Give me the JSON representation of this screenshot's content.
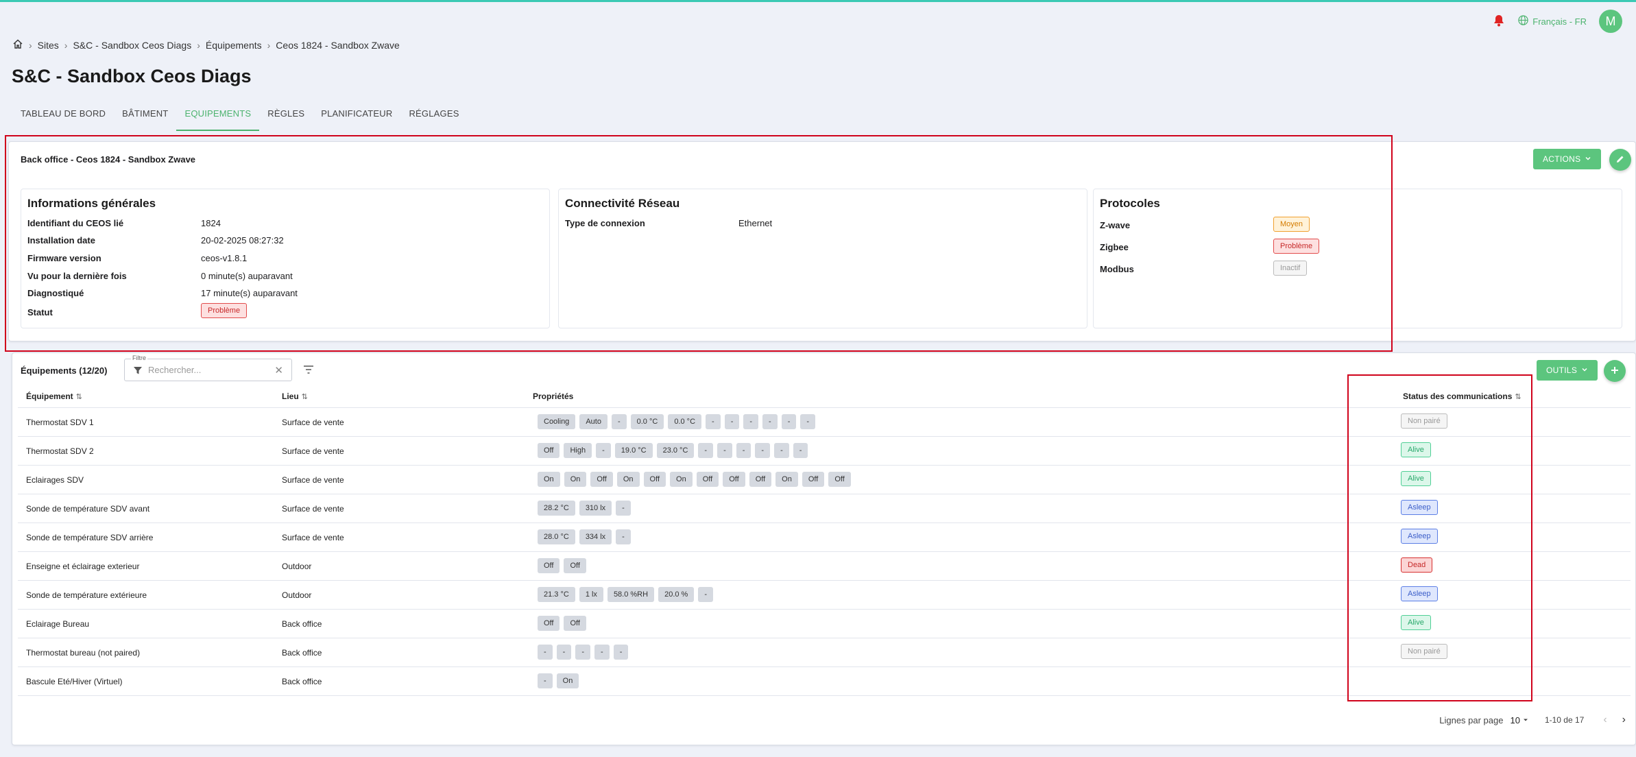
{
  "header": {
    "language": "Français - FR",
    "avatar_initial": "M"
  },
  "breadcrumb": [
    "Sites",
    "S&C - Sandbox Ceos Diags",
    "Équipements",
    "Ceos 1824 - Sandbox Zwave"
  ],
  "page_title": "S&C - Sandbox Ceos Diags",
  "tabs": [
    {
      "label": "TABLEAU DE BORD",
      "active": false
    },
    {
      "label": "BÂTIMENT",
      "active": false
    },
    {
      "label": "EQUIPEMENTS",
      "active": true
    },
    {
      "label": "RÈGLES",
      "active": false
    },
    {
      "label": "PLANIFICATEUR",
      "active": false
    },
    {
      "label": "RÉGLAGES",
      "active": false
    }
  ],
  "device_card": {
    "title": "Back office - Ceos 1824 - Sandbox Zwave",
    "actions_label": "ACTIONS",
    "general": {
      "heading": "Informations générales",
      "fields": [
        {
          "key": "Identifiant du CEOS lié",
          "value": "1824"
        },
        {
          "key": "Installation date",
          "value": "20-02-2025 08:27:32"
        },
        {
          "key": "Firmware version",
          "value": "ceos-v1.8.1"
        },
        {
          "key": "Vu pour la dernière fois",
          "value": "0 minute(s) auparavant"
        },
        {
          "key": "Diagnostiqué",
          "value": "17 minute(s) auparavant"
        }
      ],
      "status_key": "Statut",
      "status_value": "Problème"
    },
    "network": {
      "heading": "Connectivité Réseau",
      "key": "Type de connexion",
      "value": "Ethernet"
    },
    "protocols": {
      "heading": "Protocoles",
      "items": [
        {
          "name": "Z-wave",
          "status": "Moyen",
          "tone": "orange"
        },
        {
          "name": "Zigbee",
          "status": "Problème",
          "tone": "red"
        },
        {
          "name": "Modbus",
          "status": "Inactif",
          "tone": "grey"
        }
      ]
    }
  },
  "equipment_card": {
    "title": "Équipements (12/20)",
    "filter_legend": "Filtre",
    "filter_placeholder": "Rechercher...",
    "tools_label": "OUTILS",
    "columns": {
      "equipment": "Équipement",
      "location": "Lieu",
      "properties": "Propriétés",
      "comm_status": "Status des communications"
    },
    "rows": [
      {
        "name": "Thermostat SDV 1",
        "location": "Surface de vente",
        "props": [
          "Cooling",
          "Auto",
          "-",
          "0.0 °C",
          "0.0 °C",
          "-",
          "-",
          "-",
          "-",
          "-",
          "-"
        ],
        "status": "Non pairé",
        "tone": "grey"
      },
      {
        "name": "Thermostat SDV 2",
        "location": "Surface de vente",
        "props": [
          "Off",
          "High",
          "-",
          "19.0 °C",
          "23.0 °C",
          "-",
          "-",
          "-",
          "-",
          "-",
          "-"
        ],
        "status": "Alive",
        "tone": "green"
      },
      {
        "name": "Eclairages SDV",
        "location": "Surface de vente",
        "props": [
          "On",
          "On",
          "Off",
          "On",
          "Off",
          "On",
          "Off",
          "Off",
          "Off",
          "On",
          "Off",
          "Off"
        ],
        "status": "Alive",
        "tone": "green"
      },
      {
        "name": "Sonde de température SDV avant",
        "location": "Surface de vente",
        "props": [
          "28.2 °C",
          "310 lx",
          "-"
        ],
        "status": "Asleep",
        "tone": "blue"
      },
      {
        "name": "Sonde de température SDV arrière",
        "location": "Surface de vente",
        "props": [
          "28.0 °C",
          "334 lx",
          "-"
        ],
        "status": "Asleep",
        "tone": "blue"
      },
      {
        "name": "Enseigne et éclairage exterieur",
        "location": "Outdoor",
        "props": [
          "Off",
          "Off"
        ],
        "status": "Dead",
        "tone": "deadred"
      },
      {
        "name": "Sonde de température extérieure",
        "location": "Outdoor",
        "props": [
          "21.3 °C",
          "1 lx",
          "58.0 %RH",
          "20.0 %",
          "-"
        ],
        "status": "Asleep",
        "tone": "blue"
      },
      {
        "name": "Eclairage Bureau",
        "location": "Back office",
        "props": [
          "Off",
          "Off"
        ],
        "status": "Alive",
        "tone": "green"
      },
      {
        "name": "Thermostat bureau (not paired)",
        "location": "Back office",
        "props": [
          "-",
          "-",
          "-",
          "-",
          "-"
        ],
        "status": "Non pairé",
        "tone": "grey"
      },
      {
        "name": "Bascule Eté/Hiver (Virtuel)",
        "location": "Back office",
        "props": [
          "-",
          "On"
        ],
        "status": "",
        "tone": ""
      }
    ],
    "pagination": {
      "rows_per_page_label": "Lignes par page",
      "rows_per_page": "10",
      "range": "1-10 de 17"
    }
  },
  "colors": {
    "accent": "#5cc57e",
    "annotation": "#d0021b",
    "alert": "#e02424"
  },
  "icons": [
    "home-icon",
    "bell-icon",
    "globe-icon",
    "chevron-down-icon",
    "pencil-icon",
    "plus-icon",
    "filter-icon",
    "close-icon",
    "sort-icon",
    "chevron-left-icon",
    "chevron-right-icon"
  ]
}
